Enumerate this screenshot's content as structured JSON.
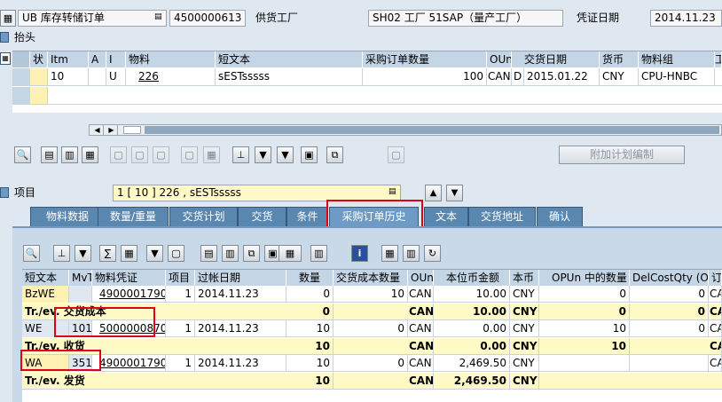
{
  "header": {
    "doc_type_value": "UB 库存转储订单",
    "po_number": "4500000613",
    "supplier_label": "供货工厂",
    "supplier_value": "SH02 工厂 51SAP（量产工厂）",
    "date_label": "凭证日期",
    "date_value": "2014.11.23"
  },
  "header_section": {
    "label": "抬头"
  },
  "items_table": {
    "columns": [
      "状",
      "Itm",
      "A",
      "I",
      "物料",
      "短文本",
      "采购订单数量",
      "OUn",
      "交货日期",
      "货币",
      "物料组",
      "工"
    ],
    "row": {
      "itm": "10",
      "i": "U",
      "material": "226",
      "short_text": "sESTsssss",
      "qty": "100",
      "oun": "CAN",
      "d": "D",
      "delivery_date": "2015.01.22",
      "currency": "CNY",
      "mat_group": "CPU-HNBC"
    }
  },
  "toolbar": {
    "extra_plan_label": "附加计划编制"
  },
  "item_detail": {
    "label": "项目",
    "selector_value": "1 [ 10 ] 226 , sESTsssss"
  },
  "tabs": [
    "物料数据",
    "数量/重量",
    "交货计划",
    "交货",
    "条件",
    "采购订单历史",
    "文本",
    "交货地址",
    "确认"
  ],
  "history": {
    "columns": [
      "短文本",
      "MvT",
      "物料凭证",
      "项目",
      "过帐日期",
      "数量",
      "交货成本数量",
      "OUn",
      "本位币金额",
      "本币",
      "OPUn 中的数量",
      "DelCostQty (OPUn)",
      "订"
    ],
    "rows": [
      {
        "kind": "data",
        "short": "BzWE",
        "mvt": "",
        "doc": "4900001790",
        "item": "1",
        "date": "2014.11.23",
        "qty": "0",
        "dcq": "10",
        "oun": "CAN",
        "amount": "10.00",
        "cur": "CNY",
        "opun": "0",
        "dcq2": "0",
        "last": "CA"
      },
      {
        "kind": "sum",
        "short": "Tr./ev. 交货成本",
        "qty": "0",
        "oun": "CAN",
        "amount": "10.00",
        "cur": "CNY",
        "opun": "0",
        "dcq2": "0",
        "last": "CA"
      },
      {
        "kind": "data",
        "short": "WE",
        "mvt": "101",
        "doc": "5000000870",
        "item": "1",
        "date": "2014.11.23",
        "qty": "10",
        "dcq": "0",
        "oun": "CAN",
        "amount": "0.00",
        "cur": "CNY",
        "opun": "10",
        "dcq2": "0",
        "last": "CA"
      },
      {
        "kind": "sum",
        "short": "Tr./ev. 收货",
        "qty": "10",
        "oun": "CAN",
        "amount": "0.00",
        "cur": "CNY",
        "opun": "10",
        "dcq2": "",
        "last": "CA"
      },
      {
        "kind": "data",
        "short": "WA",
        "mvt": "351",
        "doc": "4900001790",
        "item": "1",
        "date": "2014.11.23",
        "qty": "10",
        "dcq": "0",
        "oun": "CAN",
        "amount": "2,469.50",
        "cur": "CNY",
        "opun": "",
        "dcq2": "",
        "last": "CA"
      },
      {
        "kind": "sum",
        "short": "Tr./ev. 发货",
        "qty": "10",
        "oun": "CAN",
        "amount": "2,469.50",
        "cur": "CNY",
        "opun": "",
        "dcq2": "",
        "last": ""
      }
    ]
  },
  "colors": {
    "header_bg": "#c4d5e6",
    "sum_row": "#fff9c6",
    "tab": "#5a87b0",
    "highlight": "#e0001b"
  },
  "icons": {
    "tabs_toolbar": [
      "zoom-icon",
      "detail-icon",
      "detail2-icon",
      "delete-icon",
      "lock-icon",
      "copy-icon",
      "sort-icon",
      "filter-icon",
      "config-icon"
    ]
  }
}
